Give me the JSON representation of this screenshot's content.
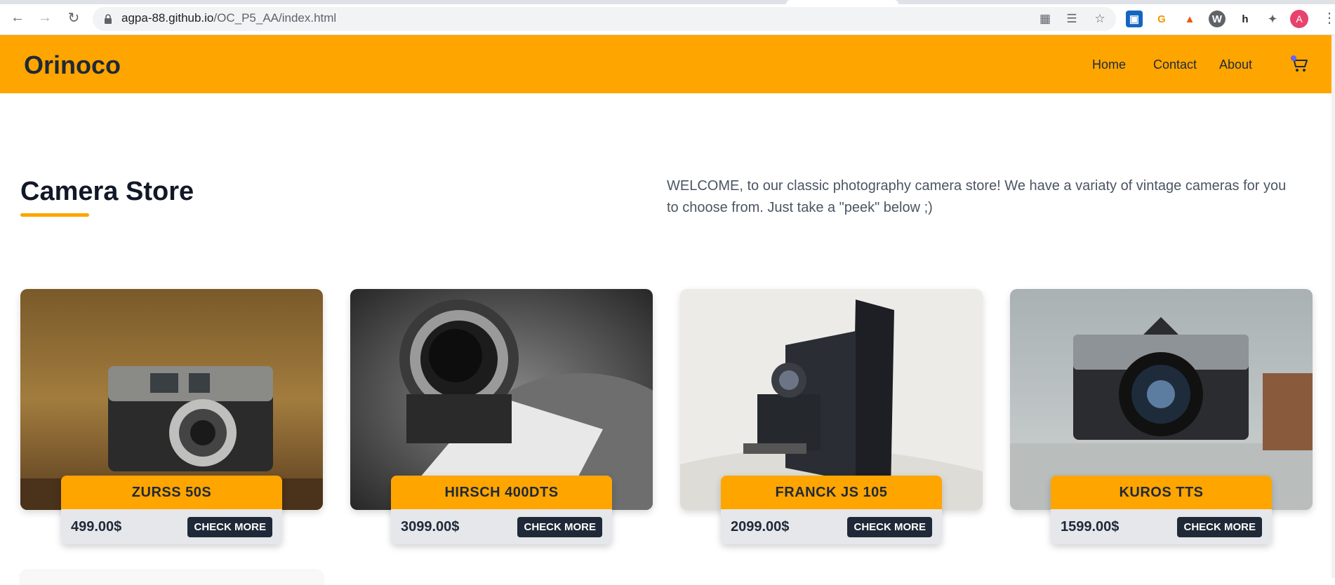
{
  "browser": {
    "url_host": "agpa-88.github.io",
    "url_path": "/OC_P5_AA/index.html",
    "profile_initial": "A",
    "icons": [
      "back-icon",
      "forward-icon",
      "reload-icon",
      "lock-icon",
      "qr-icon",
      "translate-icon",
      "star-icon",
      "extensions-icon",
      "menu-icon"
    ]
  },
  "header": {
    "brand": "Orinoco",
    "nav": [
      "Home",
      "Contact",
      "About"
    ],
    "cart_icon": "cart-icon",
    "accent": "#ffa500"
  },
  "intro": {
    "title": "Camera Store",
    "welcome": "WELCOME, to our classic photography camera store! We have a variaty of vintage cameras for you to choose from. Just take a \"peek\" below ;)"
  },
  "products": [
    {
      "name": "ZURSS 50S",
      "price": "499.00$",
      "button": "CHECK MORE"
    },
    {
      "name": "HIRSCH 400DTS",
      "price": "3099.00$",
      "button": "CHECK MORE"
    },
    {
      "name": "FRANCK JS 105",
      "price": "2099.00$",
      "button": "CHECK MORE"
    },
    {
      "name": "KUROS TTS",
      "price": "1599.00$",
      "button": "CHECK MORE"
    }
  ]
}
